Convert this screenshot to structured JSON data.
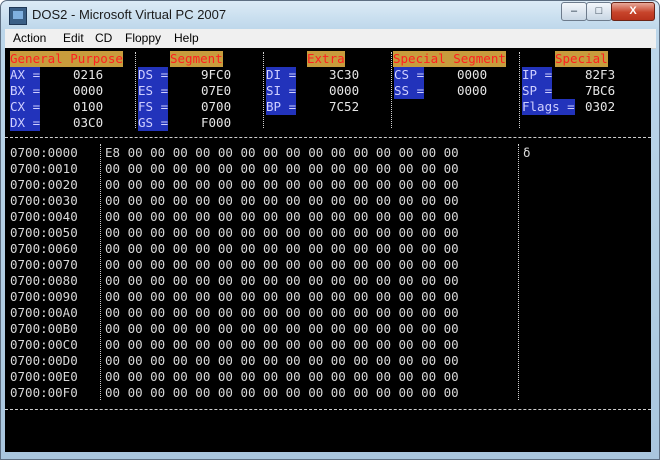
{
  "window": {
    "title": "DOS2 - Microsoft Virtual PC 2007",
    "controls": {
      "minimize": "–",
      "maximize": "□",
      "close": "X"
    }
  },
  "menu": [
    "Action",
    "Edit",
    "CD",
    "Floppy",
    "Help"
  ],
  "registers": {
    "headers": [
      "General Purpose",
      "Segment",
      "Extra",
      "Special Segment",
      "Special"
    ],
    "general": [
      {
        "label": "AX =",
        "value": "0216"
      },
      {
        "label": "BX =",
        "value": "0000"
      },
      {
        "label": "CX =",
        "value": "0100"
      },
      {
        "label": "DX =",
        "value": "03C0"
      }
    ],
    "segment": [
      {
        "label": "DS =",
        "value": "9FC0"
      },
      {
        "label": "ES =",
        "value": "07E0"
      },
      {
        "label": "FS =",
        "value": "0700"
      },
      {
        "label": "GS =",
        "value": "F000"
      }
    ],
    "extra": [
      {
        "label": "DI =",
        "value": "3C30"
      },
      {
        "label": "SI =",
        "value": "0000"
      },
      {
        "label": "BP =",
        "value": "7C52"
      }
    ],
    "special_segment": [
      {
        "label": "CS =",
        "value": "0000"
      },
      {
        "label": "SS =",
        "value": "0000"
      }
    ],
    "special": [
      {
        "label": "IP =",
        "value": "82F3"
      },
      {
        "label": "SP =",
        "value": "7BC6"
      },
      {
        "label": "Flags =",
        "value": "0302"
      }
    ]
  },
  "memory_dump": {
    "rows": [
      {
        "address": "0700:0000",
        "bytes": "E8 00 00 00 00 00 00 00 00 00 00 00 00 00 00 00",
        "ascii": "δ"
      },
      {
        "address": "0700:0010",
        "bytes": "00 00 00 00 00 00 00 00 00 00 00 00 00 00 00 00",
        "ascii": ""
      },
      {
        "address": "0700:0020",
        "bytes": "00 00 00 00 00 00 00 00 00 00 00 00 00 00 00 00",
        "ascii": ""
      },
      {
        "address": "0700:0030",
        "bytes": "00 00 00 00 00 00 00 00 00 00 00 00 00 00 00 00",
        "ascii": ""
      },
      {
        "address": "0700:0040",
        "bytes": "00 00 00 00 00 00 00 00 00 00 00 00 00 00 00 00",
        "ascii": ""
      },
      {
        "address": "0700:0050",
        "bytes": "00 00 00 00 00 00 00 00 00 00 00 00 00 00 00 00",
        "ascii": ""
      },
      {
        "address": "0700:0060",
        "bytes": "00 00 00 00 00 00 00 00 00 00 00 00 00 00 00 00",
        "ascii": ""
      },
      {
        "address": "0700:0070",
        "bytes": "00 00 00 00 00 00 00 00 00 00 00 00 00 00 00 00",
        "ascii": ""
      },
      {
        "address": "0700:0080",
        "bytes": "00 00 00 00 00 00 00 00 00 00 00 00 00 00 00 00",
        "ascii": ""
      },
      {
        "address": "0700:0090",
        "bytes": "00 00 00 00 00 00 00 00 00 00 00 00 00 00 00 00",
        "ascii": ""
      },
      {
        "address": "0700:00A0",
        "bytes": "00 00 00 00 00 00 00 00 00 00 00 00 00 00 00 00",
        "ascii": ""
      },
      {
        "address": "0700:00B0",
        "bytes": "00 00 00 00 00 00 00 00 00 00 00 00 00 00 00 00",
        "ascii": ""
      },
      {
        "address": "0700:00C0",
        "bytes": "00 00 00 00 00 00 00 00 00 00 00 00 00 00 00 00",
        "ascii": ""
      },
      {
        "address": "0700:00D0",
        "bytes": "00 00 00 00 00 00 00 00 00 00 00 00 00 00 00 00",
        "ascii": ""
      },
      {
        "address": "0700:00E0",
        "bytes": "00 00 00 00 00 00 00 00 00 00 00 00 00 00 00 00",
        "ascii": ""
      },
      {
        "address": "0700:00F0",
        "bytes": "00 00 00 00 00 00 00 00 00 00 00 00 00 00 00 00",
        "ascii": ""
      }
    ]
  }
}
